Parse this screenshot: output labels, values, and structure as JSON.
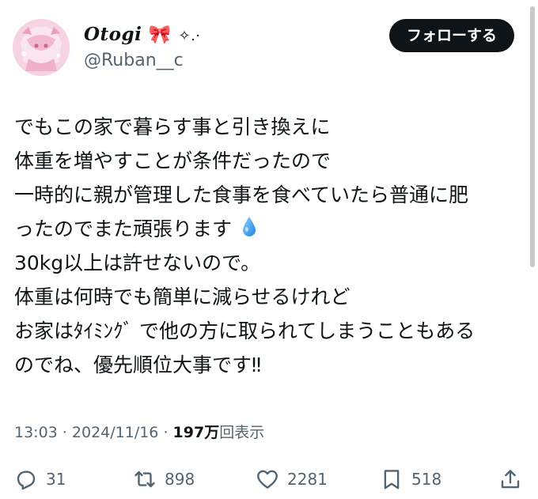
{
  "user": {
    "display_name": "Otogi",
    "display_name_bow": "🎀",
    "display_name_sparkle": "✧.·",
    "handle": "@Ruban__c",
    "avatar_icon": "avatar-pink-illustration"
  },
  "follow_button": {
    "label": "フォローする"
  },
  "tweet": {
    "lines": [
      "でもこの家で暮らす事と引き換えに",
      "体重を増やすことが条件だったので",
      "一時的に親が管理した食事を食べていたら普通に肥",
      "ったのでまた頑張ります",
      "30kg以上は許せないので。",
      "体重は何時でも簡単に減らせるけれど",
      "お家はﾀｲﾐﾝｸﾞ で他の方に取られてしまうこともある",
      "のでね、優先順位大事です‼︎"
    ],
    "emoji_icon": "droplet-icon"
  },
  "meta": {
    "time": "13:03",
    "separator1": " · ",
    "date": "2024/11/16",
    "separator2": " · ",
    "views_count": "197万",
    "views_label": "回表示"
  },
  "actions": {
    "reply": {
      "icon": "reply-icon",
      "count": "31"
    },
    "retweet": {
      "icon": "retweet-icon",
      "count": "898"
    },
    "like": {
      "icon": "heart-icon",
      "count": "2281"
    },
    "bookmark": {
      "icon": "bookmark-icon",
      "count": "518"
    },
    "share": {
      "icon": "share-icon"
    }
  },
  "colors": {
    "text": "#0f1419",
    "secondary": "#536471",
    "button_bg": "#0f1419",
    "button_text": "#ffffff",
    "droplet": "#3aa0f0"
  }
}
